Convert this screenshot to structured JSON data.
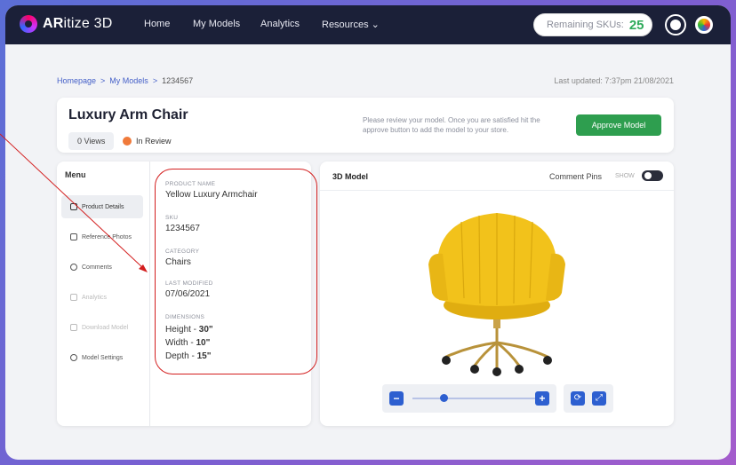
{
  "nav": {
    "brand_bold": "AR",
    "brand_rest": "itize 3D",
    "links": [
      "Home",
      "My Models",
      "Analytics",
      "Resources ⌄"
    ],
    "sku_label": "Remaining SKUs:",
    "sku_value": "25"
  },
  "breadcrumb": {
    "items": [
      "Homepage",
      "My Models",
      "1234567"
    ],
    "separator": ">",
    "last_updated": "Last updated: 7:37pm  21/08/2021"
  },
  "model_header": {
    "title": "Luxury Arm Chair",
    "views": "0 Views",
    "status": "In Review",
    "note": "Please review your model. Once you are satisfied hit the approve button to add the model to your store.",
    "approve_label": "Approve Model"
  },
  "menu": {
    "title": "Menu",
    "items": [
      {
        "label": "Product Details",
        "icon": "list-icon"
      },
      {
        "label": "Reference Photos",
        "icon": "image-icon"
      },
      {
        "label": "Comments",
        "icon": "comment-icon"
      },
      {
        "label": "Analytics",
        "icon": "bar-chart-icon"
      },
      {
        "label": "Download Model",
        "icon": "download-icon"
      },
      {
        "label": "Model Settings",
        "icon": "gear-icon"
      }
    ]
  },
  "details": {
    "product_name_label": "PRODUCT NAME",
    "product_name": "Yellow Luxury Armchair",
    "sku_label": "SKU",
    "sku": "1234567",
    "category_label": "CATEGORY",
    "category": "Chairs",
    "modified_label": "LAST MODIFIED",
    "modified": "07/06/2021",
    "dimensions_label": "DIMENSIONS",
    "height_label": "Height - ",
    "height": "30\"",
    "width_label": "Width - ",
    "width": "10\"",
    "depth_label": "Depth - ",
    "depth": "15\""
  },
  "viewer": {
    "title": "3D Model",
    "pins_label": "Comment Pins",
    "show_label": "SHOW",
    "zoom_minus": "−",
    "zoom_plus": "+",
    "zoom_level": 0.25,
    "chair_color": "#f2c21b"
  },
  "colors": {
    "nav_bg": "#1b2038",
    "accent_blue": "#2d5fd0",
    "approve_green": "#2e9e4f",
    "sku_green": "#2eaa5a",
    "status_orange": "#f07a3a",
    "annotation_red": "#d31e1e"
  }
}
